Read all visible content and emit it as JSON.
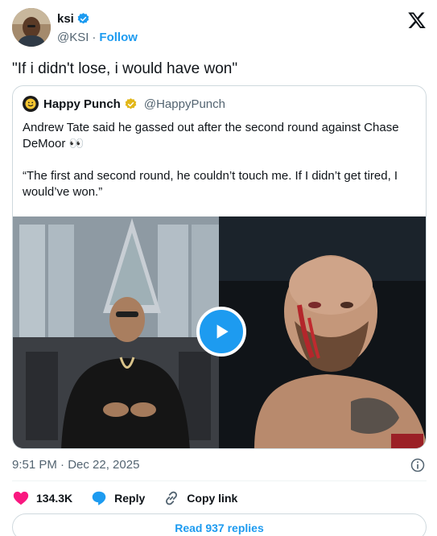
{
  "author": {
    "name": "ksi",
    "handle": "@KSI",
    "separator": "·",
    "follow_label": "Follow"
  },
  "tweet": {
    "text": "\"If i didn't lose, i would have won\"",
    "timestamp": "9:51 PM · Dec 22, 2025"
  },
  "quoted": {
    "name": "Happy Punch",
    "handle": "@HappyPunch",
    "paragraph1": "Andrew Tate said he gassed out after the second round against Chase DeMoor 👀",
    "paragraph2": "“The first and second round, he couldn’t touch me. If I didn’t get tired, I would’ve won.”"
  },
  "actions": {
    "likes": "134.3K",
    "reply_label": "Reply",
    "copy_label": "Copy link"
  },
  "read_replies": "Read 937 replies",
  "colors": {
    "accent": "#1d9bf0",
    "like": "#f91880",
    "verified_gold": "#e2b719"
  },
  "icons": [
    "verified-icon",
    "x-logo-icon",
    "play-icon",
    "info-icon",
    "heart-icon",
    "reply-icon",
    "link-icon"
  ]
}
